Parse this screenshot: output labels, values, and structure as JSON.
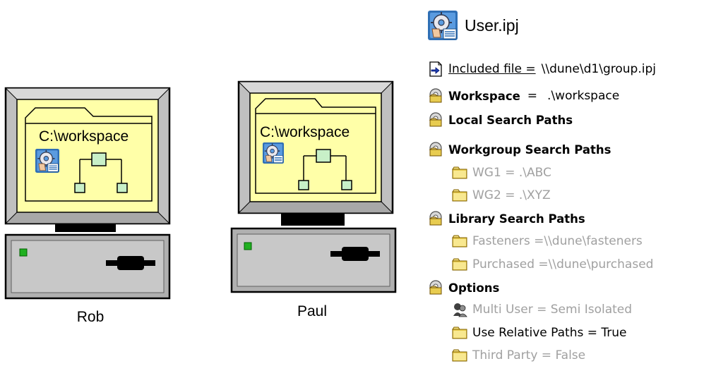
{
  "computers": [
    {
      "user": "Rob",
      "workspace_path": "C:\\workspace"
    },
    {
      "user": "Paul",
      "workspace_path": "C:\\workspace"
    }
  ],
  "project": {
    "file": "User.ipj",
    "included_file_label": "Included file =",
    "included_file_value": "\\\\dune\\d1\\group.ipj",
    "workspace_label": "Workspace",
    "workspace_eq": "=",
    "workspace_value": ".\\workspace",
    "local_search_paths": "Local Search Paths",
    "workgroup_search_paths": "Workgroup Search Paths",
    "workgroup_items": [
      "WG1 = .\\ABC",
      "WG2 = .\\XYZ"
    ],
    "library_search_paths": "Library Search Paths",
    "library_items": [
      "Fasteners =\\\\dune\\fasteners",
      "Purchased =\\\\dune\\purchased"
    ],
    "options": "Options",
    "option_items": {
      "multi_user": "Multi User = Semi Isolated",
      "relative_paths": "Use Relative Paths = True",
      "third_party": "Third Party = False"
    }
  },
  "colors": {
    "monitor_frame": "#c0c0c0",
    "screen": "#ffffa8",
    "folder_node": "#c8f0c8",
    "power_led": "#20b020",
    "gray_text": "#a0a0a0",
    "folder_yellow": "#f0d860"
  },
  "icons": {
    "project": "inventor-project-icon",
    "include": "include-file-icon",
    "group": "group-folder-icon",
    "folder": "folder-icon",
    "multi_user": "multi-user-icon"
  }
}
